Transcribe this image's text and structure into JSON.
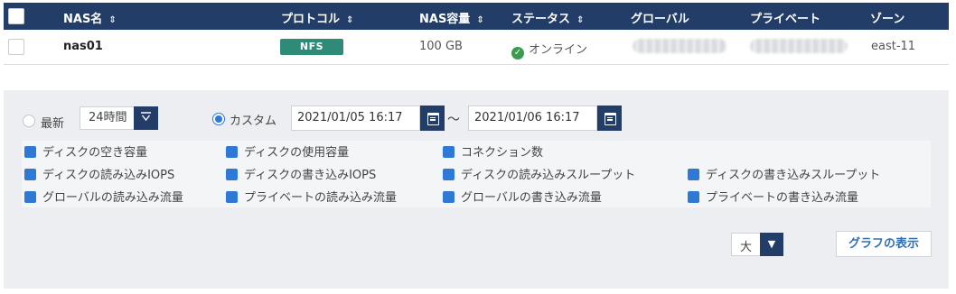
{
  "table": {
    "columns": {
      "name": "NAS名",
      "protocol": "プロトコル",
      "capacity": "NAS容量",
      "status": "ステータス",
      "global": "グローバル",
      "private": "プライベート",
      "zone": "ゾーン"
    },
    "sort_icon": "⇕",
    "row": {
      "name": "nas01",
      "protocol": "NFS",
      "capacity": "100 GB",
      "status": "オンライン",
      "zone": "east-11"
    },
    "colors": {
      "header_bg": "#223d67",
      "protocol_badge": "#2e8b78",
      "status_ok": "#3a9b4f"
    }
  },
  "panel": {
    "range": {
      "latest_label": "最新",
      "latest_value": "24時間",
      "custom_label": "カスタム",
      "start": "2021/01/05 16:17",
      "separator": "～",
      "end": "2021/01/06 16:17"
    },
    "metrics": [
      "ディスクの空き容量",
      "ディスクの使用容量",
      "コネクション数",
      "ディスクの読み込みIOPS",
      "ディスクの書き込みIOPS",
      "ディスクの読み込みスループット",
      "ディスクの書き込みスループット",
      "グローバルの読み込み流量",
      "プライベートの読み込み流量",
      "グローバルの書き込み流量",
      "プライベートの書き込み流量"
    ],
    "size_value": "大",
    "show_graph_label": "グラフの表示",
    "accent": "#2f79d6"
  }
}
